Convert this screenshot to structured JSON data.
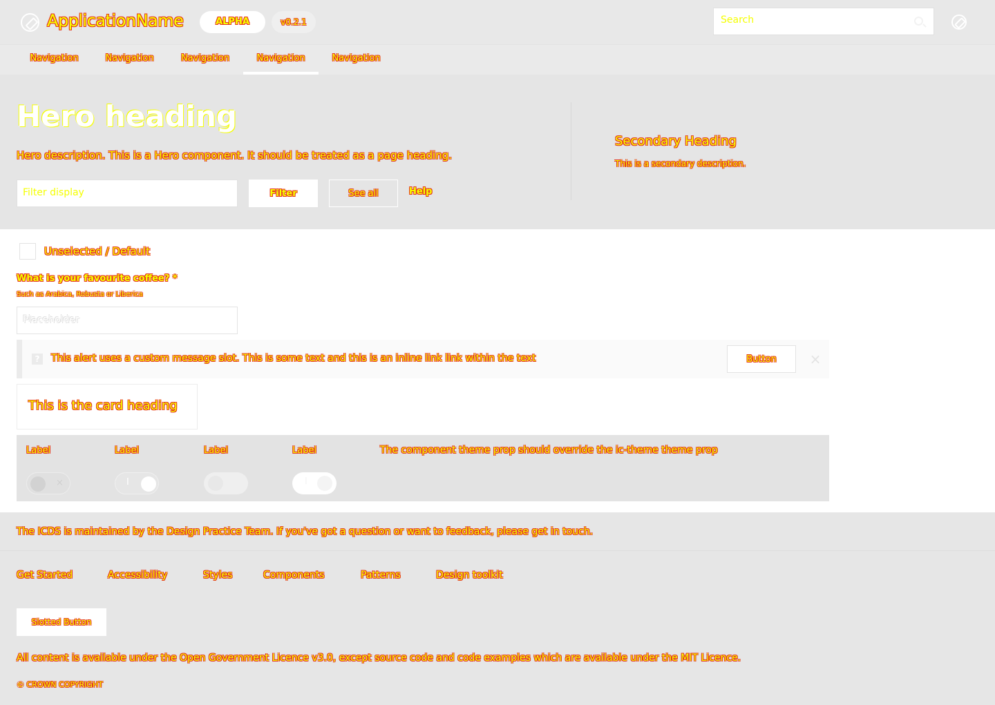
{
  "header": {
    "app_name": "ApplicationName",
    "tag_alpha": "ALPHA",
    "tag_version": "v0.2.1",
    "search_placeholder": "Search"
  },
  "nav": {
    "items": [
      {
        "label": "Navigation",
        "active": false
      },
      {
        "label": "Navigation",
        "active": false
      },
      {
        "label": "Navigation",
        "active": false
      },
      {
        "label": "Navigation",
        "active": true
      },
      {
        "label": "Navigation",
        "active": false
      }
    ]
  },
  "hero": {
    "heading": "Hero heading",
    "description": "Hero description. This is a Hero component. It should be treated as a page heading.",
    "filter_placeholder": "Filter display",
    "filter_button": "Filter",
    "see_all_button": "See all",
    "help_link": "Help",
    "secondary_heading": "Secondary Heading",
    "secondary_description": "This is a secondary description."
  },
  "form": {
    "checkbox_label": "Unselected / Default",
    "coffee_label": "What is your favourite coffee? *",
    "coffee_hint": "Such as Arabica, Robusta or Liberica",
    "coffee_placeholder": "Placeholder"
  },
  "alert": {
    "icon": "?",
    "message": "This alert uses a custom message slot. This is some text and this is an inline link link within the text",
    "button": "Button",
    "close": "×"
  },
  "card": {
    "heading": "This is the card heading"
  },
  "toggles": {
    "labels": [
      "Label",
      "Label",
      "Label",
      "Label"
    ],
    "note": "The component theme prop should override the ic-theme theme prop",
    "marks": [
      "×",
      "I",
      "",
      "I"
    ]
  },
  "footer": {
    "maintained": "The ICDS is maintained by the Design Practice Team. If you've got a question or want to feedback, please get in touch.",
    "links": [
      "Get Started",
      "Accessibility",
      "Styles",
      "Components",
      "Patterns",
      "Design toolkit"
    ],
    "slotted_button": "Slotted Button",
    "license": "All content is available under the Open Government Licence v3.0, except source code and code examples which are available under the MIT Licence.",
    "copyright": "© CROWN COPYRIGHT"
  }
}
